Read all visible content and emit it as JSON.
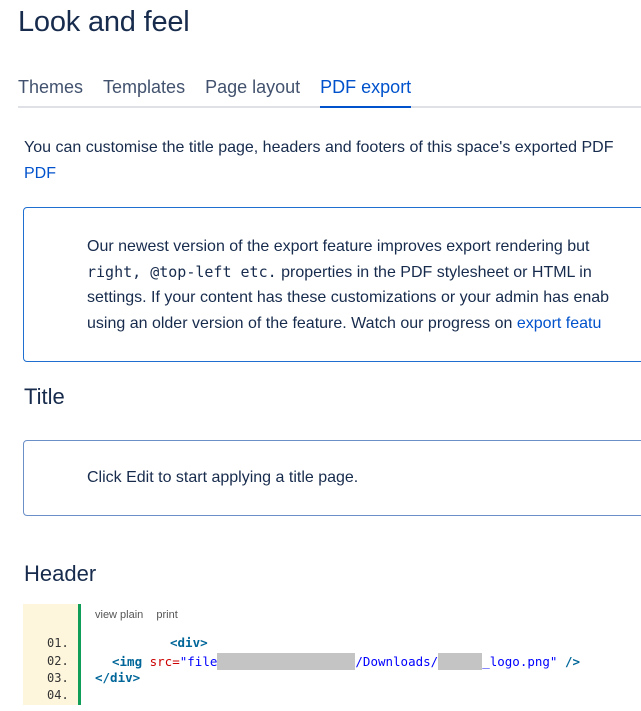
{
  "page": {
    "title": "Look and feel"
  },
  "tabs": [
    {
      "label": "Themes",
      "active": false
    },
    {
      "label": "Templates",
      "active": false
    },
    {
      "label": "Page layout",
      "active": false
    },
    {
      "label": "PDF export",
      "active": true
    }
  ],
  "intro": {
    "text": "You can customise the title page, headers and footers of this space's exported PDF",
    "link": "PDF"
  },
  "info_panel": {
    "line1": "Our newest version of the export feature improves export rendering but",
    "line2_code": "right, @top-left etc.",
    "line2_text": " properties in the PDF stylesheet or HTML in",
    "line3": "settings. If your content has these customizations or your admin has enab",
    "line4_text": "using an older version of the feature. Watch our progress on ",
    "line4_link": "export featu"
  },
  "title_section": {
    "heading": "Title",
    "message": "Click Edit to start applying a title page."
  },
  "header_section": {
    "heading": "Header",
    "toolbar": {
      "view_plain": "view plain",
      "print": "print"
    },
    "line_numbers": [
      "01.",
      "02.",
      "03.",
      "04."
    ],
    "code": {
      "line1": "<div>",
      "line2_tag": "<img",
      "line2_attr": " src=",
      "line2_str_start": "\"file",
      "line2_str_mid": "/Downloads/",
      "line2_str_end": "_logo.png\"",
      "line2_close": " />",
      "line3": "</div>"
    }
  }
}
